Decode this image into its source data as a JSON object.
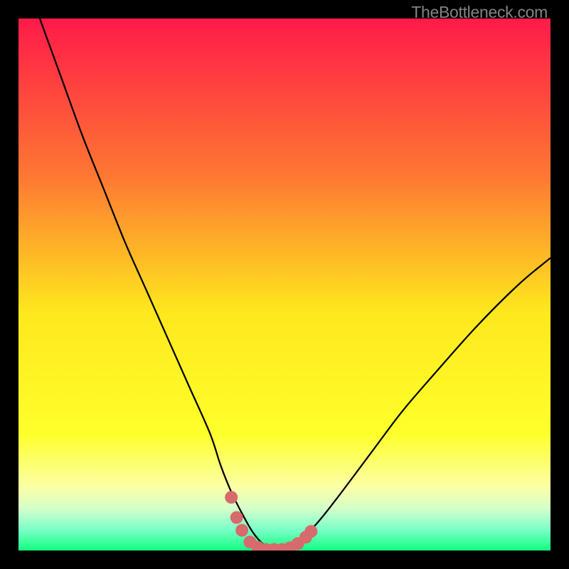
{
  "watermark": "TheBottleneck.com",
  "chart_data": {
    "type": "line",
    "title": "",
    "xlabel": "",
    "ylabel": "",
    "xlim": [
      0,
      100
    ],
    "ylim": [
      0,
      100
    ],
    "gradient_stops": [
      {
        "offset": 0,
        "color": "#ff1a49"
      },
      {
        "offset": 30,
        "color": "#fe7932"
      },
      {
        "offset": 55,
        "color": "#fee71e"
      },
      {
        "offset": 78,
        "color": "#feff2a"
      },
      {
        "offset": 88,
        "color": "#fbffa5"
      },
      {
        "offset": 92,
        "color": "#d6ffc9"
      },
      {
        "offset": 96,
        "color": "#7cffc9"
      },
      {
        "offset": 100,
        "color": "#12ff80"
      }
    ],
    "series": [
      {
        "name": "bottleneck-curve",
        "color": "#000000",
        "x": [
          4,
          8,
          12,
          16,
          20,
          24,
          28,
          32,
          36,
          38,
          40,
          42,
          44,
          46,
          48,
          50,
          52,
          56,
          60,
          66,
          72,
          78,
          86,
          94,
          100
        ],
        "y": [
          100,
          89,
          78,
          68,
          58,
          49,
          40,
          31,
          22,
          16,
          11,
          7,
          3.5,
          1.2,
          0.3,
          0.3,
          1.2,
          5,
          10,
          18,
          26,
          33,
          42,
          50,
          55
        ]
      }
    ],
    "markers": {
      "name": "bottom-dots",
      "color": "#d66a6c",
      "radius": 1.2,
      "points": [
        {
          "x": 40.0,
          "y": 10.0
        },
        {
          "x": 41.0,
          "y": 6.2
        },
        {
          "x": 42.0,
          "y": 3.8
        },
        {
          "x": 43.5,
          "y": 1.6
        },
        {
          "x": 45.0,
          "y": 0.6
        },
        {
          "x": 46.5,
          "y": 0.2
        },
        {
          "x": 48.0,
          "y": 0.2
        },
        {
          "x": 49.5,
          "y": 0.2
        },
        {
          "x": 51.0,
          "y": 0.5
        },
        {
          "x": 52.5,
          "y": 1.3
        },
        {
          "x": 54.0,
          "y": 2.5
        },
        {
          "x": 55.0,
          "y": 3.6
        }
      ]
    }
  }
}
